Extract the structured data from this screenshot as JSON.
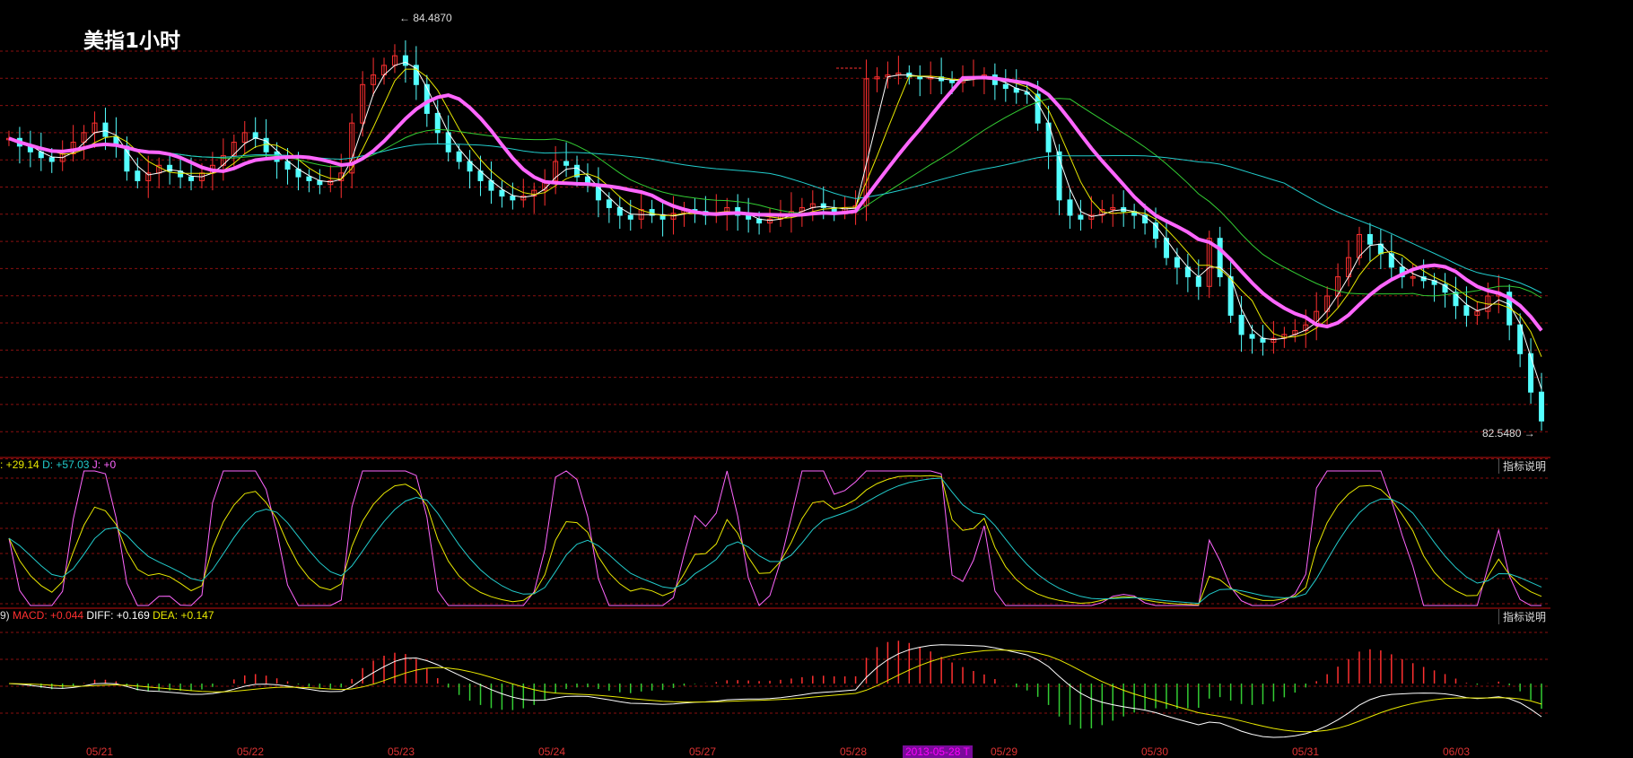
{
  "title": "美指1小时",
  "price_high_label": "84.4870",
  "price_low_label": "82.5480",
  "kdj_legend": {
    "k": "29.14",
    "d": "D: +57.03",
    "j": "J: +0"
  },
  "macd_legend": {
    "prefix": "9)",
    "macd": "MACD: +0.044",
    "diff": "DIFF: +0.169",
    "dea": "DEA: +0.147"
  },
  "explain_button": "指标说明",
  "date_axis": [
    "05/21",
    "05/22",
    "05/23",
    "05/24",
    "05/27",
    "05/28",
    "05/29",
    "05/30",
    "05/31",
    "06/03"
  ],
  "date_highlight": "2013-05-28 T",
  "colors": {
    "background": "#000000",
    "up": "#ff3030",
    "down": "#54ffff",
    "grid": "#8a1010",
    "ma_thick": "#ff66ff",
    "ma_yellow": "#e8e800",
    "ma_green": "#33cc33",
    "ma_cyan": "#22cccc",
    "ma_white": "#ffffff"
  },
  "chart_data": [
    {
      "type": "candlestick",
      "title": "美指1小时",
      "ylim": [
        82.5,
        84.6
      ],
      "annotations": {
        "high": 84.487,
        "low": 82.548
      },
      "closes": [
        84.02,
        83.98,
        83.95,
        83.92,
        83.9,
        83.94,
        84.0,
        84.05,
        84.1,
        84.03,
        83.98,
        83.85,
        83.8,
        83.84,
        83.88,
        83.85,
        83.82,
        83.8,
        83.84,
        83.88,
        83.93,
        84.0,
        84.05,
        84.02,
        83.95,
        83.9,
        83.86,
        83.82,
        83.8,
        83.78,
        83.8,
        83.84,
        84.1,
        84.3,
        84.35,
        84.4,
        84.45,
        84.4,
        84.3,
        84.15,
        84.05,
        83.95,
        83.9,
        83.85,
        83.8,
        83.75,
        83.72,
        83.7,
        83.72,
        83.75,
        83.8,
        83.9,
        83.88,
        83.82,
        83.78,
        83.7,
        83.66,
        83.62,
        83.6,
        83.65,
        83.62,
        83.6,
        83.63,
        83.65,
        83.64,
        83.62,
        83.63,
        83.66,
        83.62,
        83.6,
        83.58,
        83.6,
        83.62,
        83.64,
        83.66,
        83.68,
        83.66,
        83.64,
        83.66,
        83.67,
        84.33,
        84.34,
        84.35,
        84.36,
        84.34,
        84.33,
        84.34,
        84.32,
        84.31,
        84.33,
        84.34,
        84.35,
        84.3,
        84.28,
        84.26,
        84.25,
        84.1,
        83.95,
        83.7,
        83.62,
        83.6,
        83.62,
        83.65,
        83.66,
        83.64,
        83.62,
        83.58,
        83.5,
        83.4,
        83.35,
        83.3,
        83.25,
        83.5,
        83.3,
        83.1,
        83.0,
        82.98,
        82.96,
        82.98,
        83.0,
        83.02,
        83.05,
        83.12,
        83.2,
        83.3,
        83.4,
        83.52,
        83.47,
        83.42,
        83.35,
        83.3,
        83.3,
        83.28,
        83.26,
        83.22,
        83.15,
        83.1,
        83.12,
        83.2,
        83.22,
        83.05,
        82.9,
        82.7,
        82.55
      ],
      "ma_series": [
        "MA5",
        "MA10",
        "MA20",
        "MA30",
        "MA60"
      ]
    },
    {
      "type": "line",
      "title": "KDJ",
      "series": [
        {
          "name": "K",
          "color": "#e8e800"
        },
        {
          "name": "D",
          "color": "#22cccc"
        },
        {
          "name": "J",
          "color": "#ff66ff"
        }
      ],
      "ylim": [
        0,
        100
      ]
    },
    {
      "type": "bar+line",
      "title": "MACD",
      "series": [
        {
          "name": "MACD",
          "color": "#ff3030"
        },
        {
          "name": "DIFF",
          "color": "#ffffff"
        },
        {
          "name": "DEA",
          "color": "#e8e800"
        }
      ],
      "values": {
        "MACD": 0.044,
        "DIFF": 0.169,
        "DEA": 0.147
      }
    }
  ]
}
